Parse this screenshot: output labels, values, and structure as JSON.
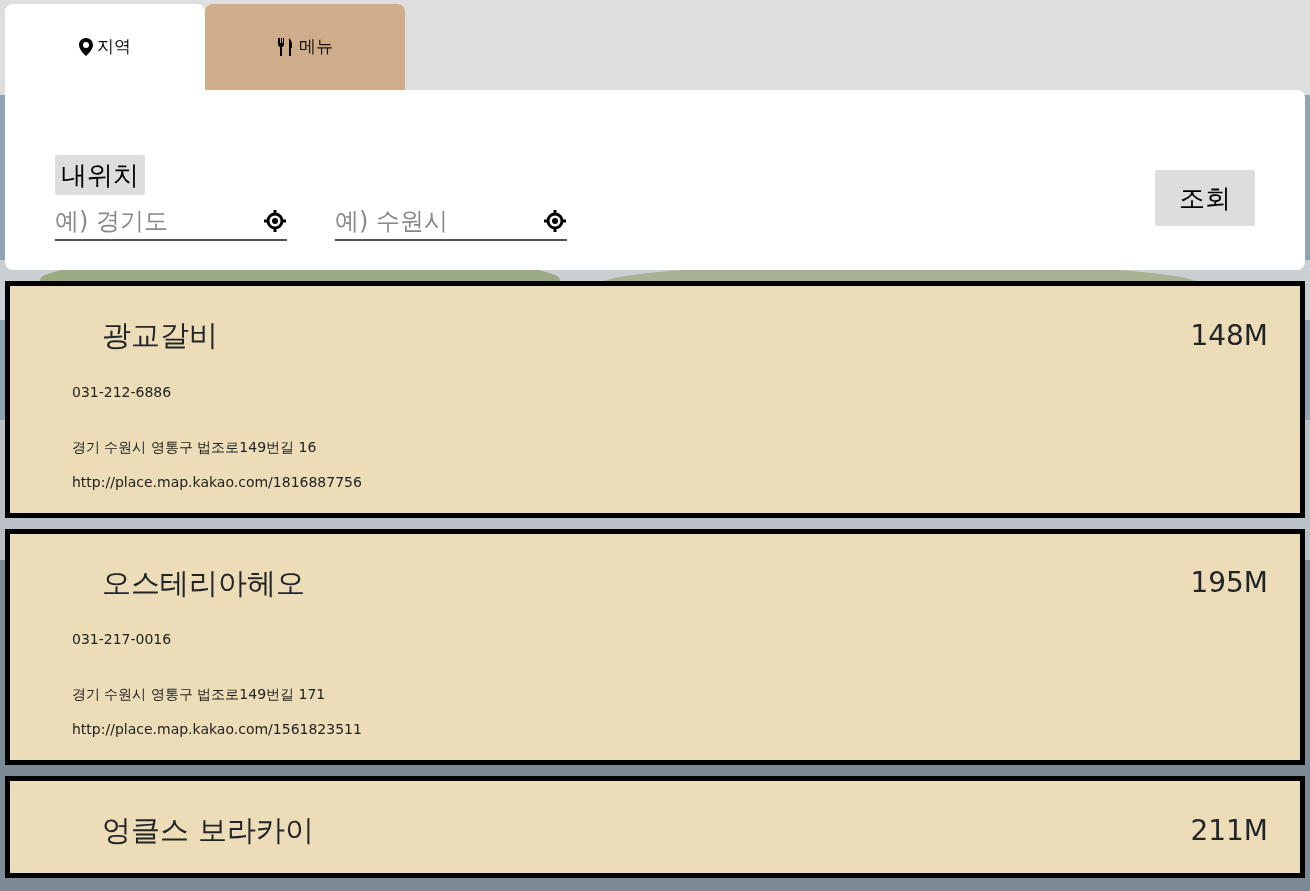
{
  "tabs": [
    {
      "label": "지역",
      "selected": true
    },
    {
      "label": "메뉴",
      "selected": false
    }
  ],
  "my_location_button": "내위치",
  "fields": [
    {
      "placeholder": "예) 경기도"
    },
    {
      "placeholder": "예) 수원시"
    }
  ],
  "search_button": "조회",
  "results": [
    {
      "name": "광교갈비",
      "distance": "148M",
      "phone": "031-212-6886",
      "address": "경기 수원시 영통구 법조로149번길 16",
      "url": "http://place.map.kakao.com/1816887756"
    },
    {
      "name": "오스테리아헤오",
      "distance": "195M",
      "phone": "031-217-0016",
      "address": "경기 수원시 영통구 법조로149번길 171",
      "url": "http://place.map.kakao.com/1561823511"
    },
    {
      "name": "엉클스 보라카이",
      "distance": "211M"
    }
  ]
}
